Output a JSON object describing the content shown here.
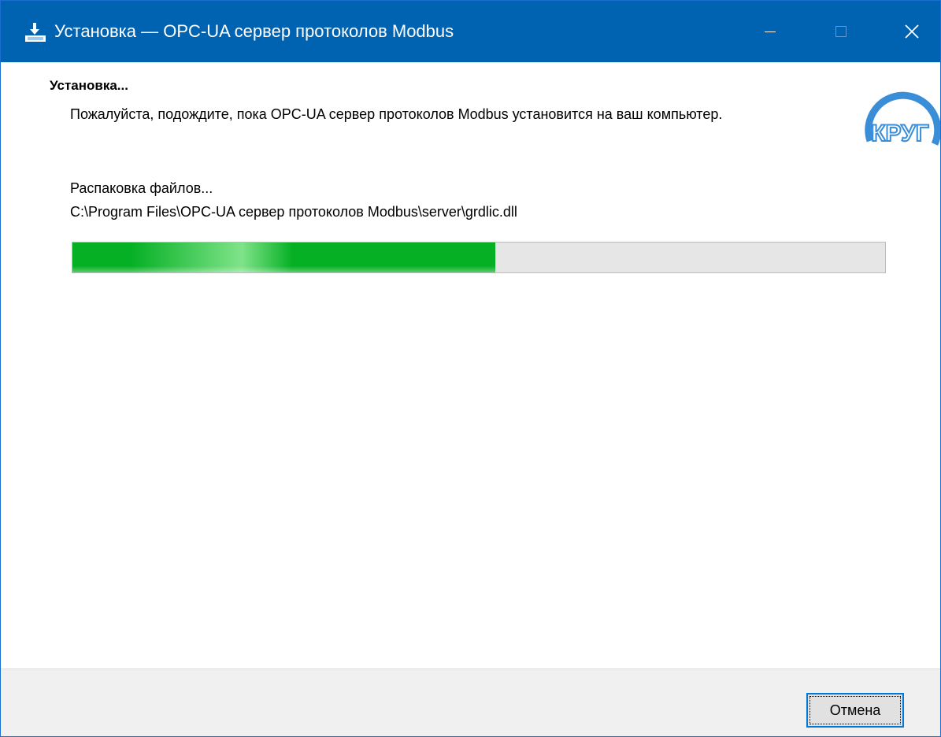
{
  "window": {
    "title": "Установка — OPC-UA сервер протоколов Modbus",
    "controls": {
      "minimize_icon": "minimize-icon",
      "maximize_icon": "maximize-icon",
      "close_icon": "close-icon"
    },
    "titlebar_color": "#0063b1"
  },
  "page": {
    "heading": "Установка...",
    "description": "Пожалуйста, подождите, пока OPC-UA сервер протоколов Modbus установится на ваш компьютер.",
    "logo": {
      "icon": "krug-logo",
      "text": "КРУГ",
      "color": "#3a8ed8"
    },
    "status": "Распаковка файлов...",
    "current_file": "C:\\Program Files\\OPC-UA сервер протоколов Modbus\\server\\grdlic.dll",
    "progress": {
      "percent": 52,
      "color": "#06b025"
    }
  },
  "footer": {
    "cancel_label": "Отмена"
  }
}
